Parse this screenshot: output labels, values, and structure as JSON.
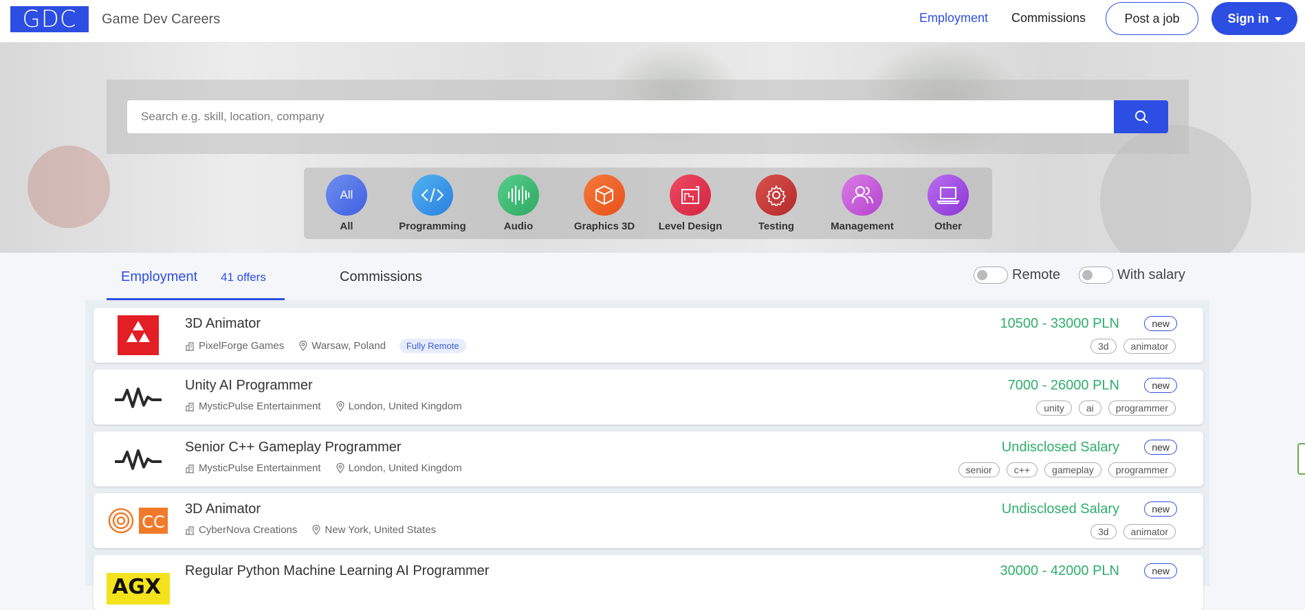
{
  "navbar": {
    "logo": "GDC",
    "brand": "Game Dev Careers",
    "links": [
      "Employment",
      "Commissions"
    ],
    "post_job": "Post a job",
    "sign_in": "Sign in"
  },
  "search": {
    "placeholder": "Search e.g. skill, location, company"
  },
  "categories": [
    {
      "label": "All",
      "icon_text": "All",
      "icon": "all-icon",
      "color": "#5b7be8"
    },
    {
      "label": "Programming",
      "icon": "code-icon",
      "color": "#3d9ae8"
    },
    {
      "label": "Audio",
      "icon": "audio-wave-icon",
      "color": "#3ebd78"
    },
    {
      "label": "Graphics 3D",
      "icon": "cube-icon",
      "color": "#f0602a"
    },
    {
      "label": "Level Design",
      "icon": "blueprint-icon",
      "color": "#e2344f"
    },
    {
      "label": "Testing",
      "icon": "gear-icon",
      "color": "#c9393b"
    },
    {
      "label": "Management",
      "icon": "users-icon",
      "color": "#c75ad8"
    },
    {
      "label": "Other",
      "icon": "laptop-icon",
      "color": "#a14ee0"
    }
  ],
  "tabs": {
    "employment": "Employment",
    "offers": "41 offers",
    "commissions": "Commissions",
    "remote": "Remote",
    "with_salary": "With salary"
  },
  "jobs": [
    {
      "title": "3D Animator",
      "company": "PixelForge Games",
      "location": "Warsaw, Poland",
      "badge": "Fully Remote",
      "salary": "10500 - 33000 PLN",
      "new": "new",
      "tags": [
        "3d",
        "animator"
      ],
      "logo": "triforce-logo"
    },
    {
      "title": "Unity AI Programmer",
      "company": "MysticPulse Entertainment",
      "location": "London, United Kingdom",
      "salary": "7000 - 26000 PLN",
      "new": "new",
      "tags": [
        "unity",
        "ai",
        "programmer"
      ],
      "logo": "pulse-logo"
    },
    {
      "title": "Senior C++ Gameplay Programmer",
      "company": "MysticPulse Entertainment",
      "location": "London, United Kingdom",
      "salary": "Undisclosed Salary",
      "new": "new",
      "tags": [
        "senior",
        "c++",
        "gameplay",
        "programmer"
      ],
      "logo": "pulse-logo"
    },
    {
      "title": "3D Animator",
      "company": "CyberNova Creations",
      "location": "New York, United States",
      "salary": "Undisclosed Salary",
      "new": "new",
      "tags": [
        "3d",
        "animator"
      ],
      "logo": "cc-logo"
    },
    {
      "title": "Regular Python Machine Learning AI Programmer",
      "salary": "30000 - 42000 PLN",
      "new": "new",
      "logo": "agx-logo"
    }
  ]
}
